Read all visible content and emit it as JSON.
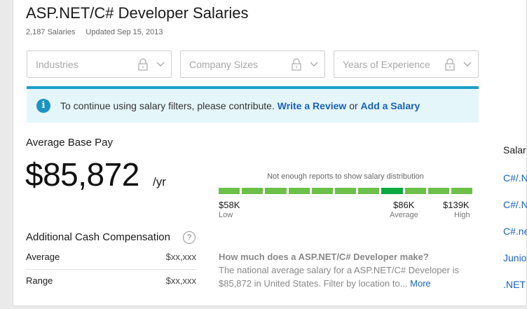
{
  "header": {
    "title": "ASP.NET/C# Developer Salaries",
    "salary_count": "2,187 Salaries",
    "updated": "Updated Sep 15, 2013"
  },
  "filters": [
    {
      "placeholder": "Industries"
    },
    {
      "placeholder": "Company Sizes"
    },
    {
      "placeholder": "Years of Experience"
    }
  ],
  "banner": {
    "message": "To continue using salary filters, please contribute.",
    "link_review": "Write a Review",
    "or": "or",
    "link_salary": "Add a Salary",
    "accent_color": "#1aa0c8"
  },
  "pay": {
    "label": "Average Base Pay",
    "amount": "$85,872",
    "unit": "/yr"
  },
  "distribution": {
    "note": "Not enough reports to show salary distribution",
    "segment_count": 11,
    "highlight_index": 7,
    "low_value": "$58K",
    "low_label": "Low",
    "avg_value": "$86K",
    "avg_label": "Average",
    "high_value": "$139K",
    "high_label": "High",
    "bar_color": "#6cc04a",
    "highlight_color": "#0caa41"
  },
  "additional": {
    "title": "Additional Cash Compensation",
    "help_icon": "question-icon",
    "rows": [
      {
        "label": "Average",
        "value": "$xx,xxx"
      },
      {
        "label": "Range",
        "value": "$xx,xxx"
      }
    ]
  },
  "faq": {
    "question": "How much does a ASP.NET/C# Developer make?",
    "answer": "The national average salary for a ASP.NET/C# Developer is $85,872 in United States. Filter by location to...",
    "more": "More"
  },
  "sidebar": {
    "heading": "Salar",
    "links": [
      "C#/.N",
      "C#/.N",
      "C#.ne",
      "Junio",
      ".NET"
    ]
  }
}
